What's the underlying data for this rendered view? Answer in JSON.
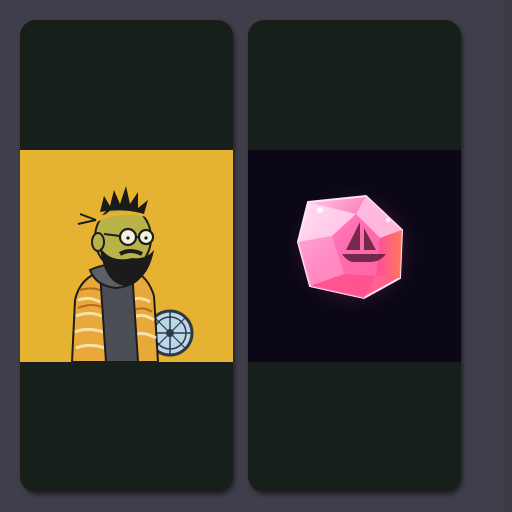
{
  "cards": [
    {
      "title": "",
      "media": {
        "alt_kind": "illustration",
        "background_color": "#e6b232",
        "subject_icon": "bearded-man-with-fan-avatar"
      }
    },
    {
      "title": "",
      "media": {
        "alt_kind": "illustration",
        "background_color": "#0b0717",
        "subject_icon": "pink-crystal-with-ship-logo"
      }
    }
  ],
  "colors": {
    "page_background": "#3f3e4a",
    "card_background": "#161f1a",
    "gem_pink": "#ff6ab0",
    "gem_highlight": "#ffd0ea"
  }
}
